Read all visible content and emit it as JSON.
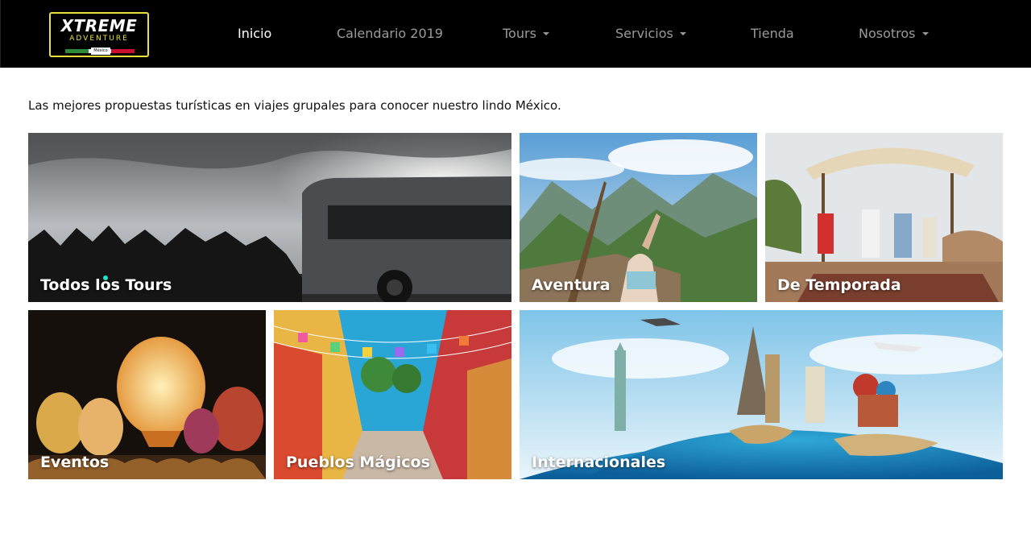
{
  "brand": {
    "name": "XTREME",
    "subtitle": "ADVENTURE",
    "country": "México",
    "colors": {
      "frame": "#e8e23a",
      "green": "#2e8b3a",
      "white": "#ffffff",
      "red": "#c8102e"
    }
  },
  "nav": {
    "items": [
      {
        "label": "Inicio",
        "active": true,
        "dropdown": false
      },
      {
        "label": "Calendario 2019",
        "active": false,
        "dropdown": false
      },
      {
        "label": "Tours",
        "active": false,
        "dropdown": true
      },
      {
        "label": "Servicios",
        "active": false,
        "dropdown": true
      },
      {
        "label": "Tienda",
        "active": false,
        "dropdown": false
      },
      {
        "label": "Nosotros",
        "active": false,
        "dropdown": true
      }
    ]
  },
  "intro": "Las mejores propuestas turísticas en viajes grupales para conocer nuestro lindo México.",
  "tiles": [
    {
      "label": "Todos los Tours"
    },
    {
      "label": "Aventura"
    },
    {
      "label": "De Temporada"
    },
    {
      "label": "Eventos"
    },
    {
      "label": "Pueblos Mágicos"
    },
    {
      "label": "Internacionales"
    }
  ]
}
